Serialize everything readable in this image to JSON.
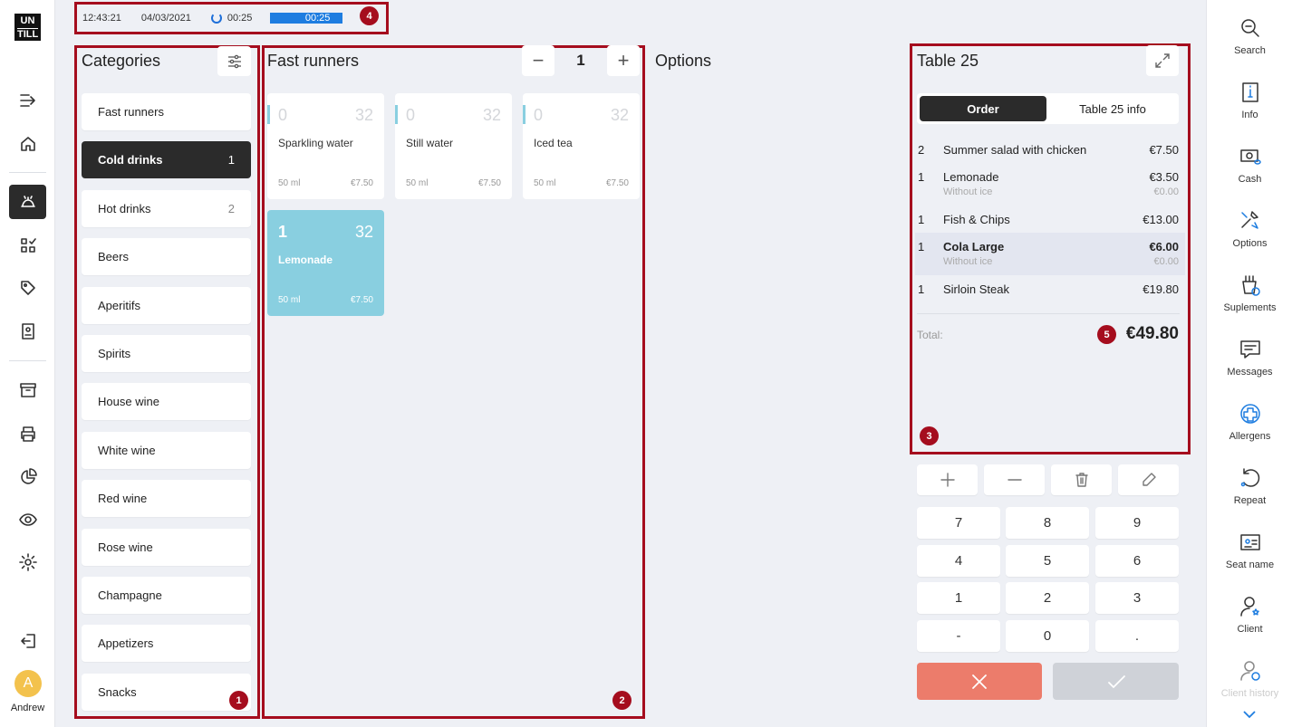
{
  "status": {
    "time": "12:43:21",
    "date": "04/03/2021",
    "timer": "00:25",
    "timer_bar": "00:25",
    "marker": "4"
  },
  "leftnav": {
    "logo_top": "UN",
    "logo_bottom": "TILL",
    "icons": [
      "forward-icon",
      "home-icon",
      "tables-icon",
      "apps-icon",
      "tag-icon",
      "receipt-icon",
      "archive-icon",
      "printer-icon",
      "report-icon",
      "view-icon",
      "settings-icon",
      "logout-icon"
    ],
    "avatar_letter": "A",
    "user_name": "Andrew"
  },
  "categories": {
    "title": "Categories",
    "marker": "1",
    "items": [
      {
        "label": "Fast runners",
        "count": ""
      },
      {
        "label": "Cold drinks",
        "count": "1"
      },
      {
        "label": "Hot drinks",
        "count": "2"
      },
      {
        "label": "Beers",
        "count": ""
      },
      {
        "label": "Aperitifs",
        "count": ""
      },
      {
        "label": "Spirits",
        "count": ""
      },
      {
        "label": "House wine",
        "count": ""
      },
      {
        "label": "White wine",
        "count": ""
      },
      {
        "label": "Red wine",
        "count": ""
      },
      {
        "label": "Rose wine",
        "count": ""
      },
      {
        "label": "Champagne",
        "count": ""
      },
      {
        "label": "Appetizers",
        "count": ""
      },
      {
        "label": "Snacks",
        "count": ""
      }
    ]
  },
  "products": {
    "title": "Fast runners",
    "qty": "1",
    "marker": "2",
    "items": [
      {
        "qty": "0",
        "num": "32",
        "name": "Sparkling water",
        "volume": "50 ml",
        "price": "€7.50"
      },
      {
        "qty": "0",
        "num": "32",
        "name": "Still water",
        "volume": "50 ml",
        "price": "€7.50"
      },
      {
        "qty": "0",
        "num": "32",
        "name": "Iced tea",
        "volume": "50 ml",
        "price": "€7.50"
      },
      {
        "qty": "1",
        "num": "32",
        "name": "Lemonade",
        "volume": "50 ml",
        "price": "€7.50"
      }
    ]
  },
  "options": {
    "title": "Options"
  },
  "order": {
    "title": "Table 25",
    "tab_order": "Order",
    "tab_info": "Table 25 info",
    "marker": "3",
    "rows": [
      {
        "qty": "2",
        "name": "Summer salad with chicken",
        "price": "€7.50",
        "mod": "",
        "mod_price": ""
      },
      {
        "qty": "1",
        "name": "Lemonade",
        "price": "€3.50",
        "mod": "Without ice",
        "mod_price": "€0.00"
      },
      {
        "qty": "1",
        "name": "Fish & Chips",
        "price": "€13.00",
        "mod": "",
        "mod_price": ""
      },
      {
        "qty": "1",
        "name": "Cola Large",
        "price": "€6.00",
        "mod": "Without ice",
        "mod_price": "€0.00"
      },
      {
        "qty": "1",
        "name": "Sirloin Steak",
        "price": "€19.80",
        "mod": "",
        "mod_price": ""
      }
    ],
    "total_label": "Total:",
    "total_marker": "5",
    "total": "€49.80"
  },
  "keypad": {
    "keys": [
      "7",
      "8",
      "9",
      "4",
      "5",
      "6",
      "1",
      "2",
      "3",
      "-",
      "0",
      "."
    ]
  },
  "rightnav": {
    "items": [
      {
        "label": "Search",
        "icon": "search-icon"
      },
      {
        "label": "Info",
        "icon": "info-icon"
      },
      {
        "label": "Cash",
        "icon": "cash-icon"
      },
      {
        "label": "Options",
        "icon": "tools-icon"
      },
      {
        "label": "Suplements",
        "icon": "supplements-icon"
      },
      {
        "label": "Messages",
        "icon": "message-icon"
      },
      {
        "label": "Allergens",
        "icon": "allergens-icon"
      },
      {
        "label": "Repeat",
        "icon": "repeat-icon"
      },
      {
        "label": "Seat name",
        "icon": "seat-name-icon"
      },
      {
        "label": "Client",
        "icon": "client-icon"
      },
      {
        "label": "Client history",
        "icon": "client-history-icon"
      }
    ]
  },
  "colors": {
    "accent": "#1e7de0",
    "dark": "#2b2b2b",
    "selected_product": "#89cfe0",
    "cancel": "#ec7c6b",
    "marker": "#a50d1e"
  }
}
